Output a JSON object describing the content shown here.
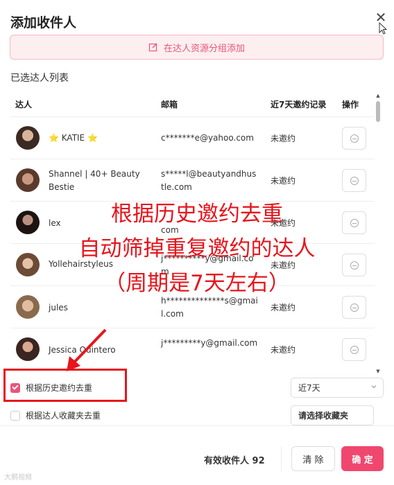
{
  "dialog": {
    "title": "添加收件人",
    "close_icon": "close-icon",
    "add_button_label": "在达人资源分组添加",
    "selected_list_label": "已选达人列表"
  },
  "table": {
    "headers": [
      "达人",
      "邮箱",
      "近7天邀约记录",
      "操作"
    ],
    "rows": [
      {
        "name": "⭐ KATIE ⭐",
        "email": "c*******e@yahoo.com",
        "record": "未邀约"
      },
      {
        "name": "Shannel | 40+ Beauty Bestie",
        "email": "s*****l@beautyandhustle.com",
        "record": "未邀约"
      },
      {
        "name": "lex",
        "email": "com",
        "record": "未邀约"
      },
      {
        "name": "Yollehairstyleus",
        "email": "j**********y@gmail.com",
        "record": "未邀约"
      },
      {
        "name": "jules",
        "email": "h**************s@gmail.com",
        "record": "未邀约"
      },
      {
        "name": "Jessica Quintero",
        "email": "j*********y@gmail.com",
        "record": "未邀约"
      }
    ]
  },
  "overlay": {
    "line1": "根据历史邀约去重",
    "line2": "自动筛掉重复邀约的达人",
    "line3": "（周期是7天左右）"
  },
  "options": {
    "dedupe_history_label": "根据历史邀约去重",
    "dedupe_history_checked": true,
    "period_value": "近7天",
    "dedupe_favorites_label": "根据达人收藏夹去重",
    "dedupe_favorites_checked": false,
    "favorites_placeholder": "请选择收藏夹"
  },
  "footer": {
    "count_label": "有效收件人 92",
    "clear_label": "清 除",
    "confirm_label": "确 定"
  },
  "watermark": "大鹅视频",
  "colors": {
    "accent": "#f0476f",
    "accent_light": "#fdeef0",
    "overlay_red": "#e6151c"
  }
}
